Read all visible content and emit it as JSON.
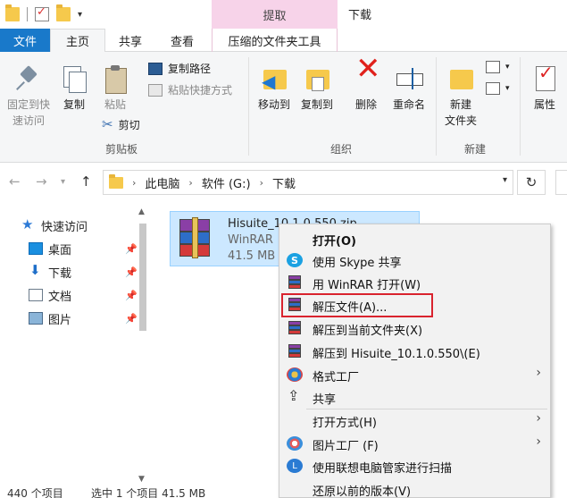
{
  "window": {
    "title": "下载",
    "contextual_header": "提取"
  },
  "tabs": [
    {
      "label": "文件"
    },
    {
      "label": "主页"
    },
    {
      "label": "共享"
    },
    {
      "label": "查看"
    },
    {
      "label": "压缩的文件夹工具"
    }
  ],
  "ribbon": {
    "clipboard": {
      "pin_label_1": "固定到快",
      "pin_label_2": "速访问",
      "copy_label": "复制",
      "paste_label": "粘贴",
      "copy_path": "复制路径",
      "paste_shortcut": "粘贴快捷方式",
      "cut_label": "剪切",
      "group": "剪贴板"
    },
    "organize": {
      "move_to": "移动到",
      "copy_to": "复制到",
      "delete": "删除",
      "rename": "重命名",
      "group": "组织"
    },
    "new": {
      "new_folder_1": "新建",
      "new_folder_2": "文件夹",
      "group": "新建"
    },
    "open": {
      "properties": "属性"
    }
  },
  "address": {
    "crumbs": [
      "此电脑",
      "软件 (G:)",
      "下载"
    ]
  },
  "nav": {
    "items": [
      {
        "label": "快速访问"
      },
      {
        "label": "桌面"
      },
      {
        "label": "下载"
      },
      {
        "label": "文档"
      },
      {
        "label": "图片"
      }
    ]
  },
  "file": {
    "name": "Hisuite_10.1.0.550.zip",
    "type": "WinRAR",
    "size": "41.5 MB"
  },
  "context_menu": {
    "items": [
      {
        "label": "打开(O)"
      },
      {
        "label": "使用 Skype 共享"
      },
      {
        "label": "用 WinRAR 打开(W)"
      },
      {
        "label": "解压文件(A)..."
      },
      {
        "label": "解压到当前文件夹(X)"
      },
      {
        "label": "解压到 Hisuite_10.1.0.550\\(E)"
      },
      {
        "label": "格式工厂"
      },
      {
        "label": "共享"
      },
      {
        "label": "打开方式(H)"
      },
      {
        "label": "图片工厂 (F)"
      },
      {
        "label": "使用联想电脑管家进行扫描"
      },
      {
        "label": "还原以前的版本(V)"
      }
    ]
  },
  "status": {
    "count": "440 个项目",
    "selected": "选中 1 个项目  41.5 MB"
  },
  "colors": {
    "accent": "#1979ca",
    "selection": "#cce8ff",
    "highlight_box": "#d9232e",
    "contextual_tab": "#f7d3e9"
  }
}
